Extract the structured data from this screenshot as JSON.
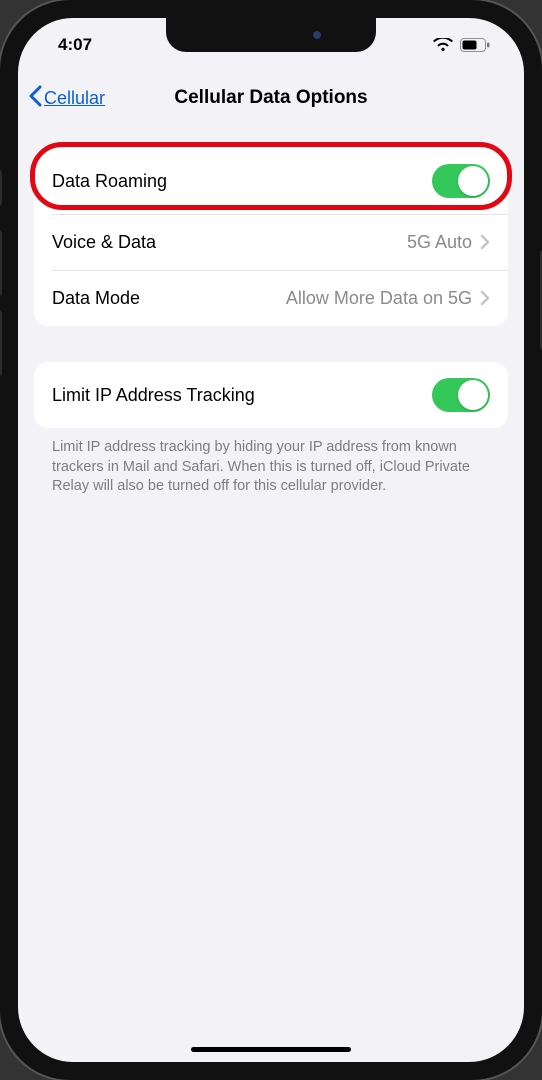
{
  "status": {
    "time": "4:07"
  },
  "nav": {
    "back_label": "Cellular",
    "title": "Cellular Data Options"
  },
  "group1": {
    "roaming_label": "Data Roaming",
    "roaming_on": true,
    "voice_label": "Voice & Data",
    "voice_value": "5G Auto",
    "mode_label": "Data Mode",
    "mode_value": "Allow More Data on 5G"
  },
  "group2": {
    "limit_ip_label": "Limit IP Address Tracking",
    "limit_ip_on": true
  },
  "footer": "Limit IP address tracking by hiding your IP address from known trackers in Mail and Safari. When this is turned off, iCloud Private Relay will also be turned off for this cellular provider."
}
